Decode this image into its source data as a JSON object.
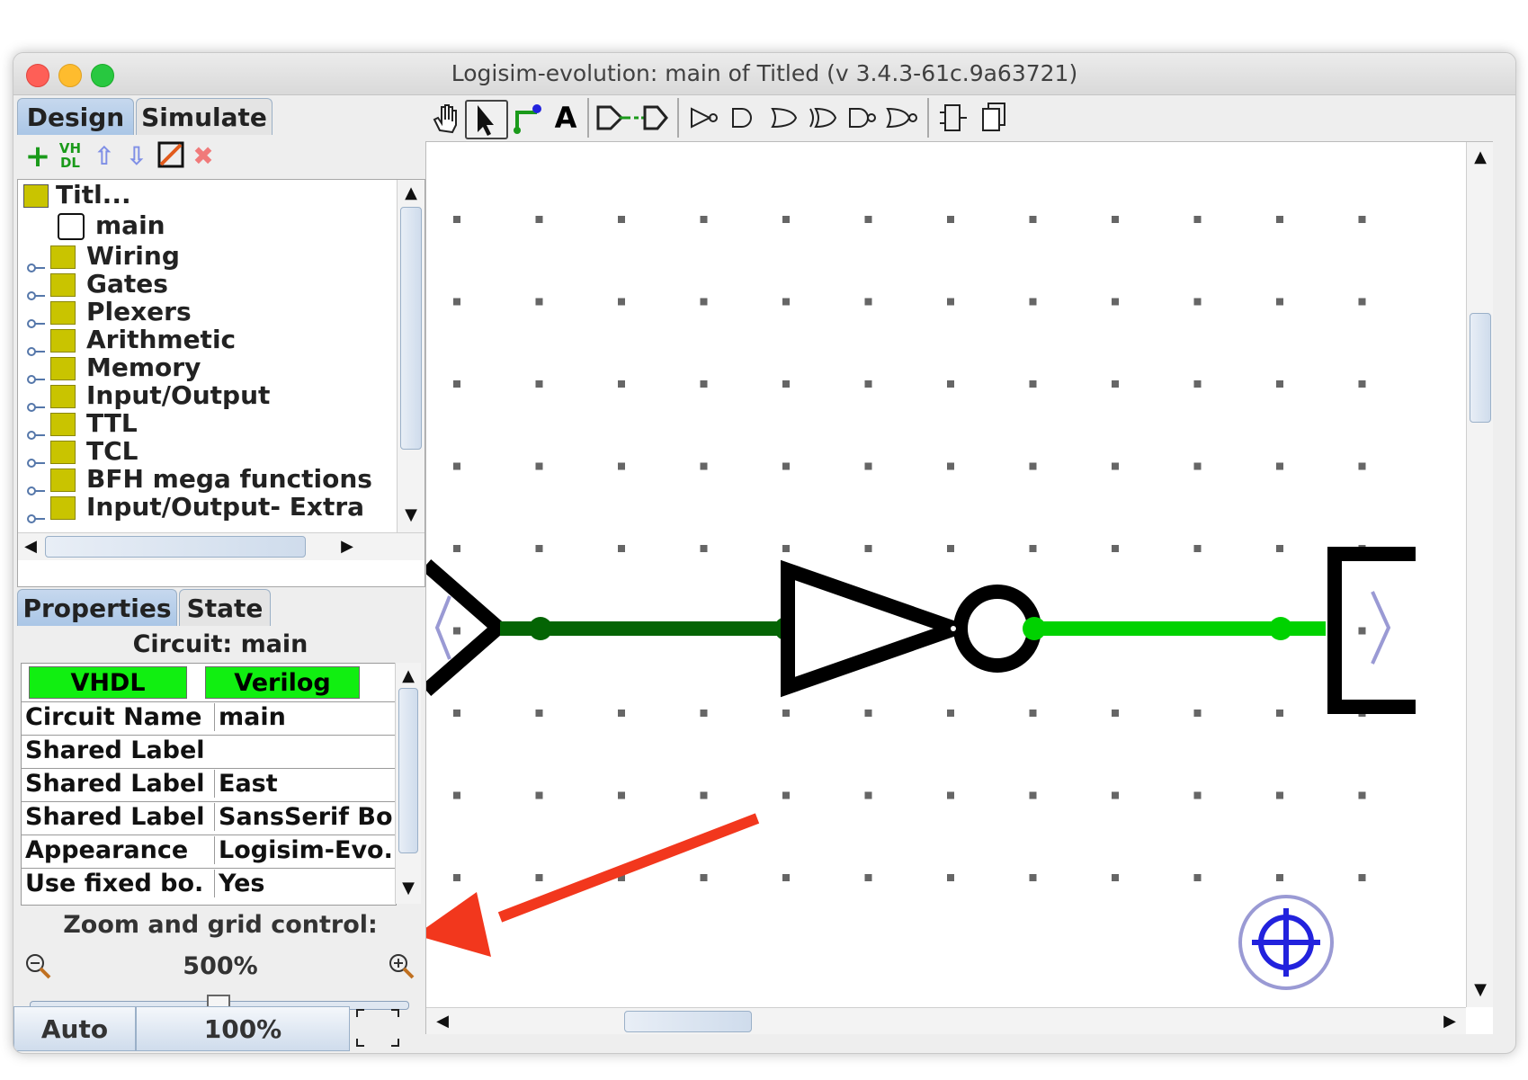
{
  "window": {
    "title": "Logisim-evolution: main of Titled (v 3.4.3-61c.9a63721)"
  },
  "left_tabs": [
    "Design",
    "Simulate"
  ],
  "explorer_toolbar": {
    "add_icon": "plus-icon",
    "vhdl_label": "VH\nDL",
    "up_icon": "arrow-up-icon",
    "down_icon": "arrow-down-icon",
    "edit_icon": "edit-appearance-icon",
    "delete_icon": "delete-icon"
  },
  "tree": {
    "root": "Titl...",
    "main": "main",
    "folders": [
      "Wiring",
      "Gates",
      "Plexers",
      "Arithmetic",
      "Memory",
      "Input/Output",
      "TTL",
      "TCL",
      "BFH mega functions",
      "Input/Output- Extra"
    ]
  },
  "props_tabs": [
    "Properties",
    "State"
  ],
  "properties": {
    "title": "Circuit: main",
    "header": [
      "VHDL",
      "Verilog"
    ],
    "rows": [
      {
        "key": "Circuit Name",
        "value": "main"
      },
      {
        "key": "Shared Label",
        "value": ""
      },
      {
        "key": "Shared Label...",
        "value": "East"
      },
      {
        "key": "Shared Label...",
        "value": "SansSerif Bo..."
      },
      {
        "key": "Appearance",
        "value": "Logisim-Evo..."
      },
      {
        "key": "Use fixed bo...",
        "value": "Yes"
      }
    ]
  },
  "zoom": {
    "label": "Zoom and grid control:",
    "value": "500%",
    "slider_fraction": 0.5,
    "auto_button": "Auto",
    "reset_button": "100%"
  },
  "colors": {
    "wire_dark": "#046404",
    "wire_light": "#00d200",
    "annotation_arrow": "#f2371d",
    "accent_blue": "#2222dd"
  }
}
